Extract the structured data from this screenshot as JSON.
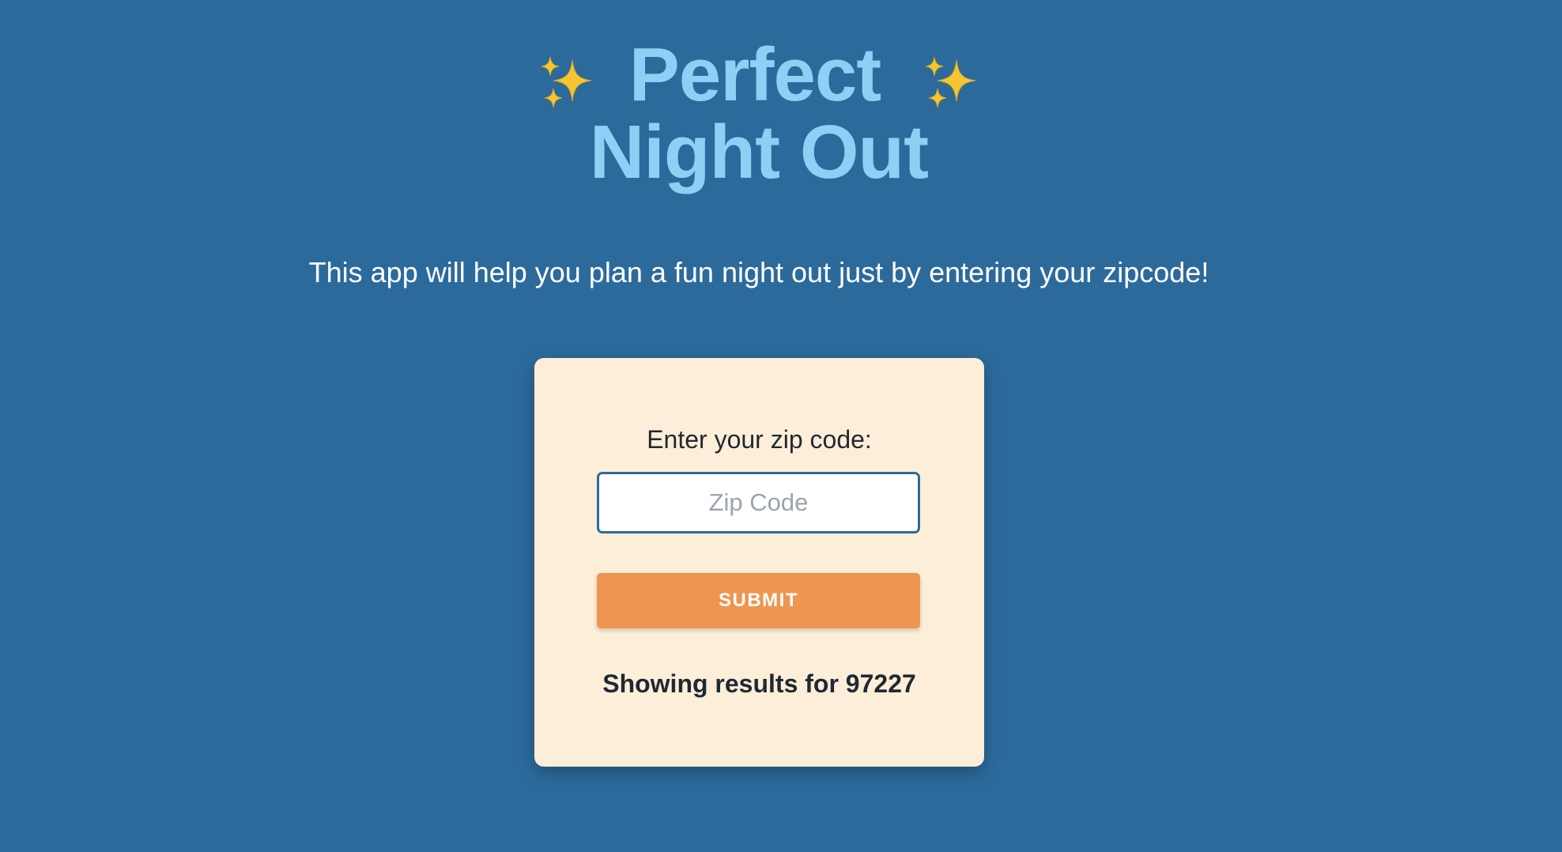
{
  "header": {
    "title_line1": "Perfect",
    "title_line2": "Night Out",
    "left_icon": "sparkles-icon",
    "right_icon": "sparkles-icon"
  },
  "intro": {
    "text": "This app will help you plan a fun night out just by entering your zipcode!"
  },
  "form": {
    "label": "Enter your zip code:",
    "input_placeholder": "Zip Code",
    "input_value": "",
    "submit_label": "SUBMIT",
    "results_text": "Showing results for 97227"
  },
  "colors": {
    "background": "#2c6a9c",
    "title": "#8fcff5",
    "card": "#fdeed9",
    "button": "#ee964f",
    "sparkle": "#f7c531"
  }
}
